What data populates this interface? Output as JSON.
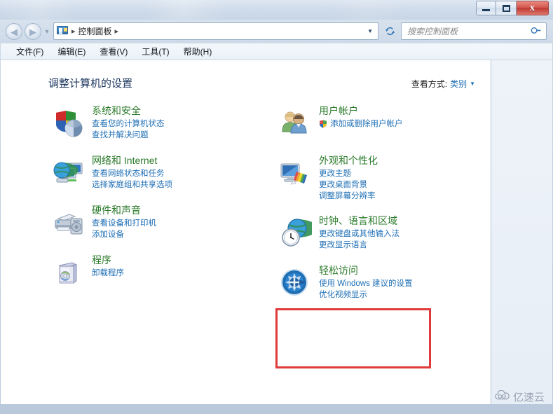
{
  "window": {
    "controls": {
      "minimize": "minimize-button",
      "maximize": "maximize-button",
      "close_label": "x"
    }
  },
  "nav": {
    "back_glyph": "◀",
    "forward_glyph": "▶",
    "history_glyph": "▼",
    "breadcrumb_icon": "control-panel-icon",
    "breadcrumb_sep": "▸",
    "breadcrumb": "控制面板",
    "address_dropdown_glyph": "▼",
    "refresh_glyph": "↻"
  },
  "search": {
    "placeholder": "搜索控制面板",
    "value": "",
    "icon_glyph": "⌕"
  },
  "menu": {
    "items": [
      {
        "label": "文件(F)"
      },
      {
        "label": "编辑(E)"
      },
      {
        "label": "查看(V)"
      },
      {
        "label": "工具(T)"
      },
      {
        "label": "帮助(H)"
      }
    ]
  },
  "main": {
    "title": "调整计算机的设置",
    "view_by_label": "查看方式:",
    "view_by_value": "类别",
    "view_by_caret": "▼"
  },
  "categories": {
    "left": [
      {
        "icon": "security-shield-icon",
        "title": "系统和安全",
        "links": [
          "查看您的计算机状态",
          "查找并解决问题"
        ]
      },
      {
        "icon": "network-globe-icon",
        "title": "网络和 Internet",
        "links": [
          "查看网络状态和任务",
          "选择家庭组和共享选项"
        ]
      },
      {
        "icon": "printer-device-icon",
        "title": "硬件和声音",
        "links": [
          "查看设备和打印机",
          "添加设备"
        ]
      },
      {
        "icon": "software-box-icon",
        "title": "程序",
        "links": [
          "卸载程序"
        ]
      }
    ],
    "right": [
      {
        "icon": "user-accounts-icon",
        "title": "用户帐户",
        "links": [
          "添加或删除用户帐户"
        ],
        "shield_on_first_link": true
      },
      {
        "icon": "appearance-monitor-icon",
        "title": "外观和个性化",
        "links": [
          "更改主题",
          "更改桌面背景",
          "调整屏幕分辨率"
        ]
      },
      {
        "icon": "clock-globe-icon",
        "title": "时钟、语言和区域",
        "links": [
          "更改键盘或其他输入法",
          "更改显示语言"
        ]
      },
      {
        "icon": "ease-of-access-icon",
        "title": "轻松访问",
        "links": [
          "使用 Windows 建议的设置",
          "优化视频显示"
        ],
        "highlighted": true
      }
    ]
  },
  "highlight": {
    "color": "#e03a3a",
    "target": "轻松访问"
  },
  "watermark": {
    "text": "亿速云",
    "icon": "cloud-logo-icon"
  },
  "colors": {
    "category_title": "#2a7a2a",
    "link": "#1f6fb5",
    "page_title": "#19335c",
    "highlight": "#e03a3a"
  }
}
